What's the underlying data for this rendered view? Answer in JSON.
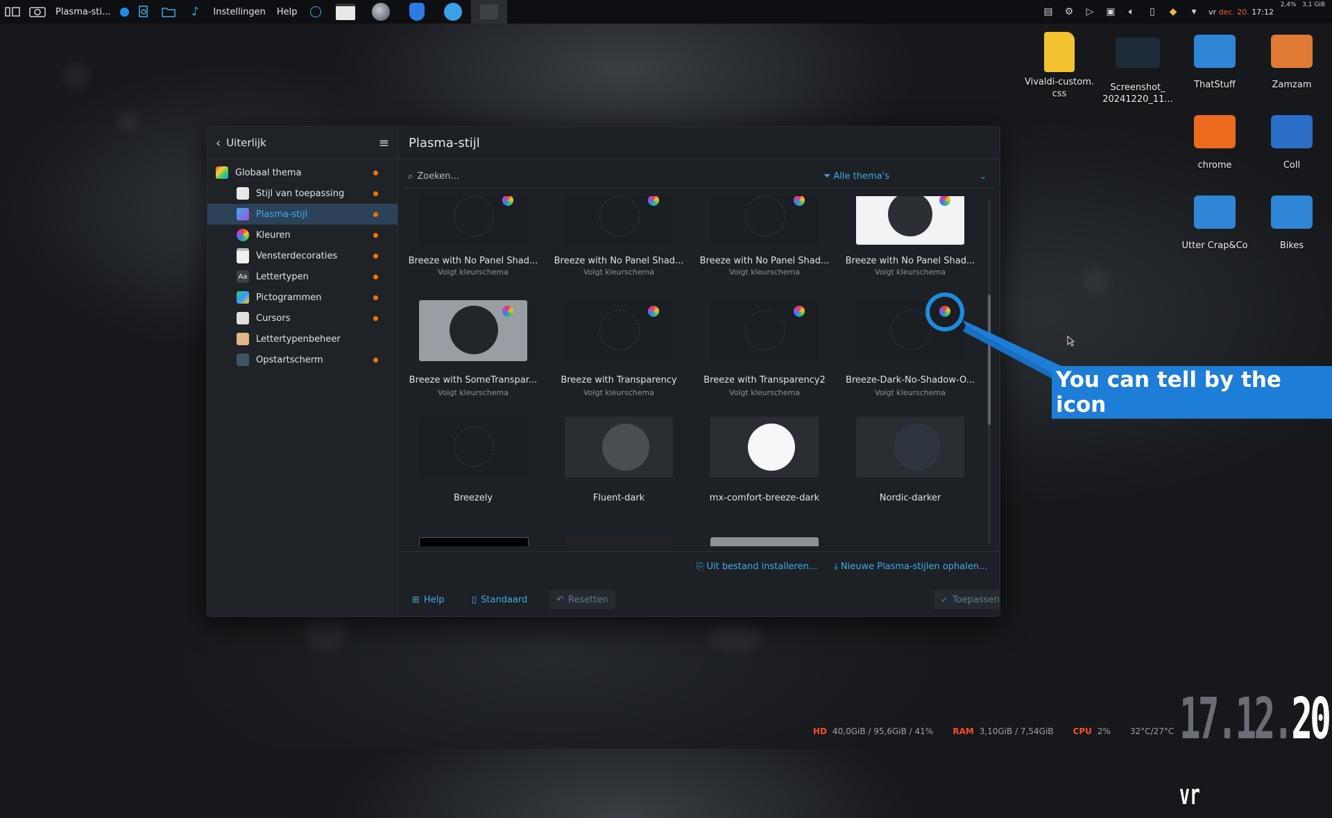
{
  "taskbar": {
    "active_window": "Plasma-sti...",
    "menu_instellingen": "Instellingen",
    "menu_help": "Help",
    "clock_day": "vr",
    "clock_date": "dec. 20.",
    "clock_time": "17:12",
    "cpu_mini": "2,4%",
    "mem_mini": "3,1 GiB"
  },
  "desktop": {
    "icons": [
      {
        "label": "Vivaldi-custom.\ncss"
      },
      {
        "label": "Screenshot_\n20241220_11..."
      },
      {
        "label": "ThatStuff"
      },
      {
        "label": "Zamzam"
      },
      {
        "label": "chrome"
      },
      {
        "label": "Coll"
      },
      {
        "label": "Utter Crap&Co"
      },
      {
        "label": "Bikes"
      }
    ]
  },
  "window": {
    "sidebar": {
      "back_label": "Uiterlijk",
      "items": [
        {
          "label": "Globaal thema",
          "modified": true
        },
        {
          "label": "Stijl van toepassing",
          "modified": true
        },
        {
          "label": "Plasma-stijl",
          "modified": true,
          "selected": true
        },
        {
          "label": "Kleuren",
          "modified": true
        },
        {
          "label": "Vensterdecoraties",
          "modified": true
        },
        {
          "label": "Lettertypen",
          "modified": true
        },
        {
          "label": "Pictogrammen",
          "modified": true
        },
        {
          "label": "Cursors",
          "modified": true
        },
        {
          "label": "Lettertypenbeheer",
          "modified": false
        },
        {
          "label": "Opstartscherm",
          "modified": true
        }
      ]
    },
    "title": "Plasma-stijl",
    "search_placeholder": "Zoeken...",
    "filter_label": "Alle thema's",
    "themes": [
      {
        "name": "Breeze with No Panel Shad...",
        "sub": "Volgt kleurschema"
      },
      {
        "name": "Breeze with No Panel Shad...",
        "sub": "Volgt kleurschema"
      },
      {
        "name": "Breeze with No Panel Shad...",
        "sub": "Volgt kleurschema"
      },
      {
        "name": "Breeze with No Panel Shad...",
        "sub": "Volgt kleurschema"
      },
      {
        "name": "Breeze with SomeTranspar...",
        "sub": "Volgt kleurschema"
      },
      {
        "name": "Breeze with Transparency",
        "sub": "Volgt kleurschema"
      },
      {
        "name": "Breeze with Transparency2",
        "sub": "Volgt kleurschema"
      },
      {
        "name": "Breeze-Dark-No-Shadow-O...",
        "sub": "Volgt kleurschema"
      },
      {
        "name": "Breezely",
        "sub": ""
      },
      {
        "name": "Fluent-dark",
        "sub": ""
      },
      {
        "name": "mx-comfort-breeze-dark",
        "sub": ""
      },
      {
        "name": "Nordic-darker",
        "sub": ""
      }
    ],
    "install_from_file": "Uit bestand installeren...",
    "get_new": "Nieuwe Plasma-stijlen ophalen...",
    "btn_help": "Help",
    "btn_default": "Standaard",
    "btn_reset": "Resetten",
    "btn_apply": "Toepassen"
  },
  "callout": "You can tell by the icon",
  "conky": {
    "hd_label": "HD",
    "hd_value": "40,0GiB / 95,6GiB / 41%",
    "ram_label": "RAM",
    "ram_value": "3,10GiB / 7,54GiB",
    "cpu_label": "CPU",
    "cpu_value": "2%",
    "temp_value": "32°C/27°C"
  },
  "big_date": {
    "day": "17",
    "month": "12",
    "year": "20",
    "weekday": "vr"
  },
  "colors": {
    "accent": "#3daee9",
    "modified_dot": "#f67400",
    "callout": "#1e7dd6",
    "conky_label": "#ff4b2b"
  }
}
